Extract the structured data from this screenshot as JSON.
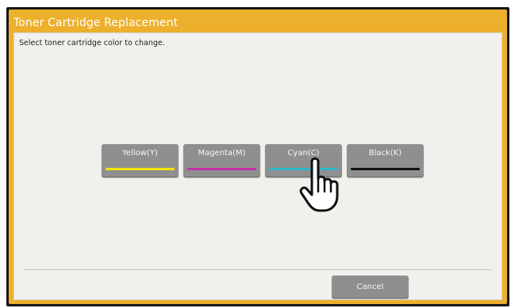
{
  "dialog": {
    "title": "Toner Cartridge Replacement",
    "instruction": "Select toner cartridge color to change."
  },
  "colors": [
    {
      "label": "Yellow(Y)",
      "stripe_color": "#f2e600"
    },
    {
      "label": "Magenta(M)",
      "stripe_color": "#c42ea9"
    },
    {
      "label": "Cyan(C)",
      "stripe_color": "#2fb7c9"
    },
    {
      "label": "Black(K)",
      "stripe_color": "#111111"
    }
  ],
  "footer": {
    "cancel_label": "Cancel"
  },
  "theme": {
    "header_color": "#edb02d",
    "button_color": "#8f8f8f"
  },
  "pointer_icon": "hand-pointer-icon"
}
